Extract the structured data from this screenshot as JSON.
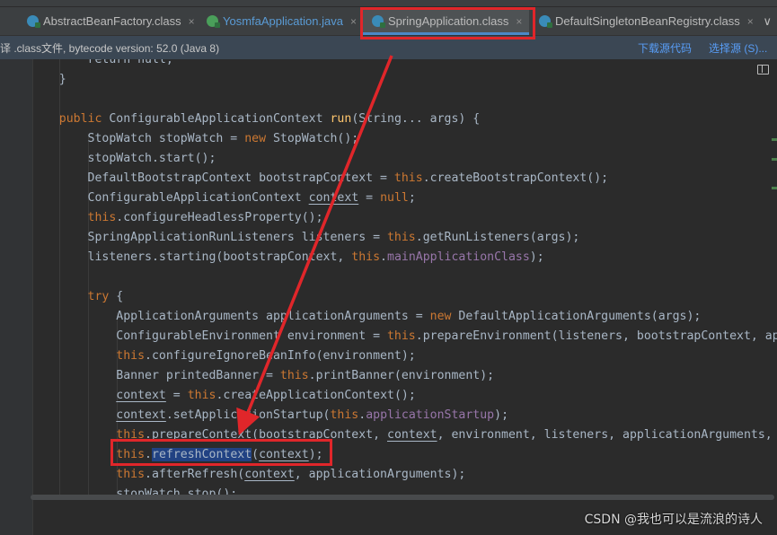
{
  "tabs": [
    {
      "name": "AbstractBeanFactory.class",
      "active": false
    },
    {
      "name": "YosmfaApplication.java",
      "active": false
    },
    {
      "name": "SpringApplication.class",
      "active": true
    },
    {
      "name": "DefaultSingletonBeanRegistry.class",
      "active": false
    }
  ],
  "tab_close_glyph": "×",
  "tab_more": "∨",
  "infobar": {
    "message": "译 .class文件, bytecode version: 52.0 (Java 8)",
    "download_link": "下载源代码",
    "choose_link": "选择源 (S)..."
  },
  "code_lines": [
    [
      {
        "t": "        return null;"
      }
    ],
    [
      {
        "t": "    }"
      }
    ],
    [],
    [
      {
        "t": "    "
      },
      {
        "t": "public ",
        "c": "kw"
      },
      {
        "t": "ConfigurableApplicationContext "
      },
      {
        "t": "run",
        "c": "fn"
      },
      {
        "t": "(String... args) {"
      }
    ],
    [
      {
        "t": "        StopWatch stopWatch = "
      },
      {
        "t": "new ",
        "c": "kw"
      },
      {
        "t": "StopWatch();"
      }
    ],
    [
      {
        "t": "        stopWatch.start();"
      }
    ],
    [
      {
        "t": "        DefaultBootstrapContext bootstrapContext = "
      },
      {
        "t": "this",
        "c": "kw"
      },
      {
        "t": ".createBootstrapContext();"
      }
    ],
    [
      {
        "t": "        ConfigurableApplicationContext "
      },
      {
        "t": "context",
        "c": "ul"
      },
      {
        "t": " = "
      },
      {
        "t": "null",
        "c": "kw"
      },
      {
        "t": ";"
      }
    ],
    [
      {
        "t": "        "
      },
      {
        "t": "this",
        "c": "kw"
      },
      {
        "t": ".configureHeadlessProperty();"
      }
    ],
    [
      {
        "t": "        SpringApplicationRunListeners listeners = "
      },
      {
        "t": "this",
        "c": "kw"
      },
      {
        "t": ".getRunListeners(args);"
      }
    ],
    [
      {
        "t": "        listeners.starting(bootstrapContext, "
      },
      {
        "t": "this",
        "c": "kw"
      },
      {
        "t": "."
      },
      {
        "t": "mainApplicationClass",
        "c": "fld"
      },
      {
        "t": ");"
      }
    ],
    [],
    [
      {
        "t": "        "
      },
      {
        "t": "try ",
        "c": "kw"
      },
      {
        "t": "{"
      }
    ],
    [
      {
        "t": "            ApplicationArguments applicationArguments = "
      },
      {
        "t": "new ",
        "c": "kw"
      },
      {
        "t": "DefaultApplicationArguments(args);"
      }
    ],
    [
      {
        "t": "            ConfigurableEnvironment environment = "
      },
      {
        "t": "this",
        "c": "kw"
      },
      {
        "t": ".prepareEnvironment(listeners, bootstrapContext, applicationArguments);"
      }
    ],
    [
      {
        "t": "            "
      },
      {
        "t": "this",
        "c": "kw"
      },
      {
        "t": ".configureIgnoreBeanInfo(environment);"
      }
    ],
    [
      {
        "t": "            Banner printedBanner = "
      },
      {
        "t": "this",
        "c": "kw"
      },
      {
        "t": ".printBanner(environment);"
      }
    ],
    [
      {
        "t": "            "
      },
      {
        "t": "context",
        "c": "ul"
      },
      {
        "t": " = "
      },
      {
        "t": "this",
        "c": "kw"
      },
      {
        "t": ".createApplicationContext();"
      }
    ],
    [
      {
        "t": "            "
      },
      {
        "t": "context",
        "c": "ul"
      },
      {
        "t": ".setApplicationStartup("
      },
      {
        "t": "this",
        "c": "kw"
      },
      {
        "t": "."
      },
      {
        "t": "applicationStartup",
        "c": "fld"
      },
      {
        "t": ");"
      }
    ],
    [
      {
        "t": "            "
      },
      {
        "t": "this",
        "c": "kw"
      },
      {
        "t": ".prepareContext(bootstrapContext, "
      },
      {
        "t": "context",
        "c": "ul"
      },
      {
        "t": ", environment, listeners, applicationArguments, printedBanner);"
      }
    ],
    [
      {
        "t": "            "
      },
      {
        "t": "this",
        "c": "kw"
      },
      {
        "t": "."
      },
      {
        "t": "refreshContext",
        "c": "sel"
      },
      {
        "t": "("
      },
      {
        "t": "context",
        "c": "ul"
      },
      {
        "t": ");"
      }
    ],
    [
      {
        "t": "            "
      },
      {
        "t": "this",
        "c": "kw"
      },
      {
        "t": ".afterRefresh("
      },
      {
        "t": "context",
        "c": "ul"
      },
      {
        "t": ", applicationArguments);"
      }
    ],
    [
      {
        "t": "            stopWatch.stop();"
      }
    ]
  ],
  "watermark": "CSDN @我也可以是流浪的诗人",
  "annotation_color": "#e0262a"
}
